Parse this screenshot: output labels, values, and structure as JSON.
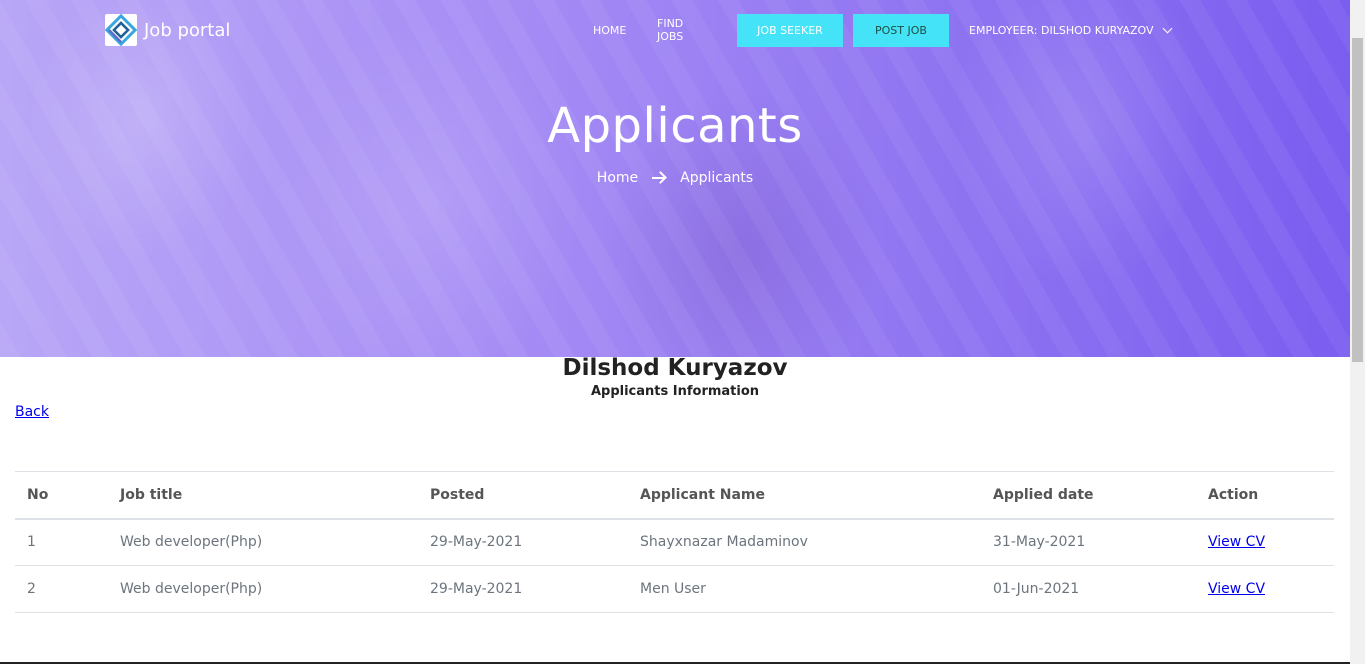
{
  "brand": {
    "name": "Job portal",
    "logo_icon": "diamond-logo-icon"
  },
  "nav": {
    "home": "HOME",
    "find_jobs": "FIND JOBS",
    "job_seeker": "JOB SEEKER",
    "post_job": "POST JOB",
    "employer": "EMPLOYEER: DILSHOD KURYAZOV",
    "accent_color": "#45e3f7"
  },
  "hero": {
    "title": "Applicants",
    "breadcrumb": {
      "home": "Home",
      "current": "Applicants"
    }
  },
  "content": {
    "owner_name": "Dilshod Kuryazov",
    "subtitle": "Applicants Information",
    "back_link": "Back"
  },
  "table": {
    "headers": [
      "No",
      "Job title",
      "Posted",
      "Applicant Name",
      "Applied date",
      "Action"
    ],
    "rows": [
      {
        "no": "1",
        "job_title": "Web developer(Php)",
        "posted": "29-May-2021",
        "applicant": "Shayxnazar Madaminov",
        "applied": "31-May-2021",
        "action": "View CV"
      },
      {
        "no": "2",
        "job_title": "Web developer(Php)",
        "posted": "29-May-2021",
        "applicant": "Men User",
        "applied": "01-Jun-2021",
        "action": "View CV"
      }
    ]
  }
}
